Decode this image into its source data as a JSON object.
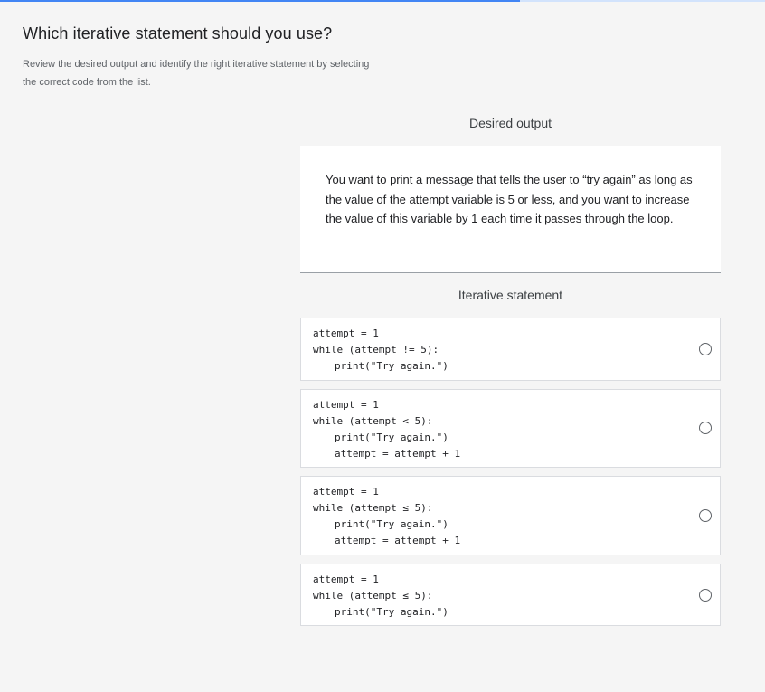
{
  "progress": {
    "fraction": 0.68
  },
  "question": {
    "title": "Which iterative statement should you use?",
    "instructions": "Review the desired output and identify the right iterative statement by selecting the correct code from the list."
  },
  "desired_output": {
    "heading": "Desired output",
    "text": "You want to print a message that tells the user to “try again” as long as the value of the attempt variable is 5 or less, and you want to increase the value of this variable by 1 each time it passes through the loop."
  },
  "iterative_statement": {
    "heading": "Iterative statement",
    "options": [
      {
        "lines": [
          "attempt = 1",
          "while (attempt != 5):",
          "print(\"Try again.\")"
        ],
        "selected": false
      },
      {
        "lines": [
          "attempt = 1",
          "while (attempt < 5):",
          "print(\"Try again.\")",
          "attempt = attempt + 1"
        ],
        "selected": false
      },
      {
        "lines": [
          "attempt = 1",
          "while (attempt ≤ 5):",
          "print(\"Try again.\")",
          "attempt = attempt + 1"
        ],
        "selected": false
      },
      {
        "lines": [
          "attempt = 1",
          "while (attempt ≤ 5):",
          "print(\"Try again.\")"
        ],
        "selected": false
      }
    ]
  },
  "colors": {
    "background": "#f5f5f5",
    "progress": "#4285f4",
    "card": "#ffffff"
  }
}
